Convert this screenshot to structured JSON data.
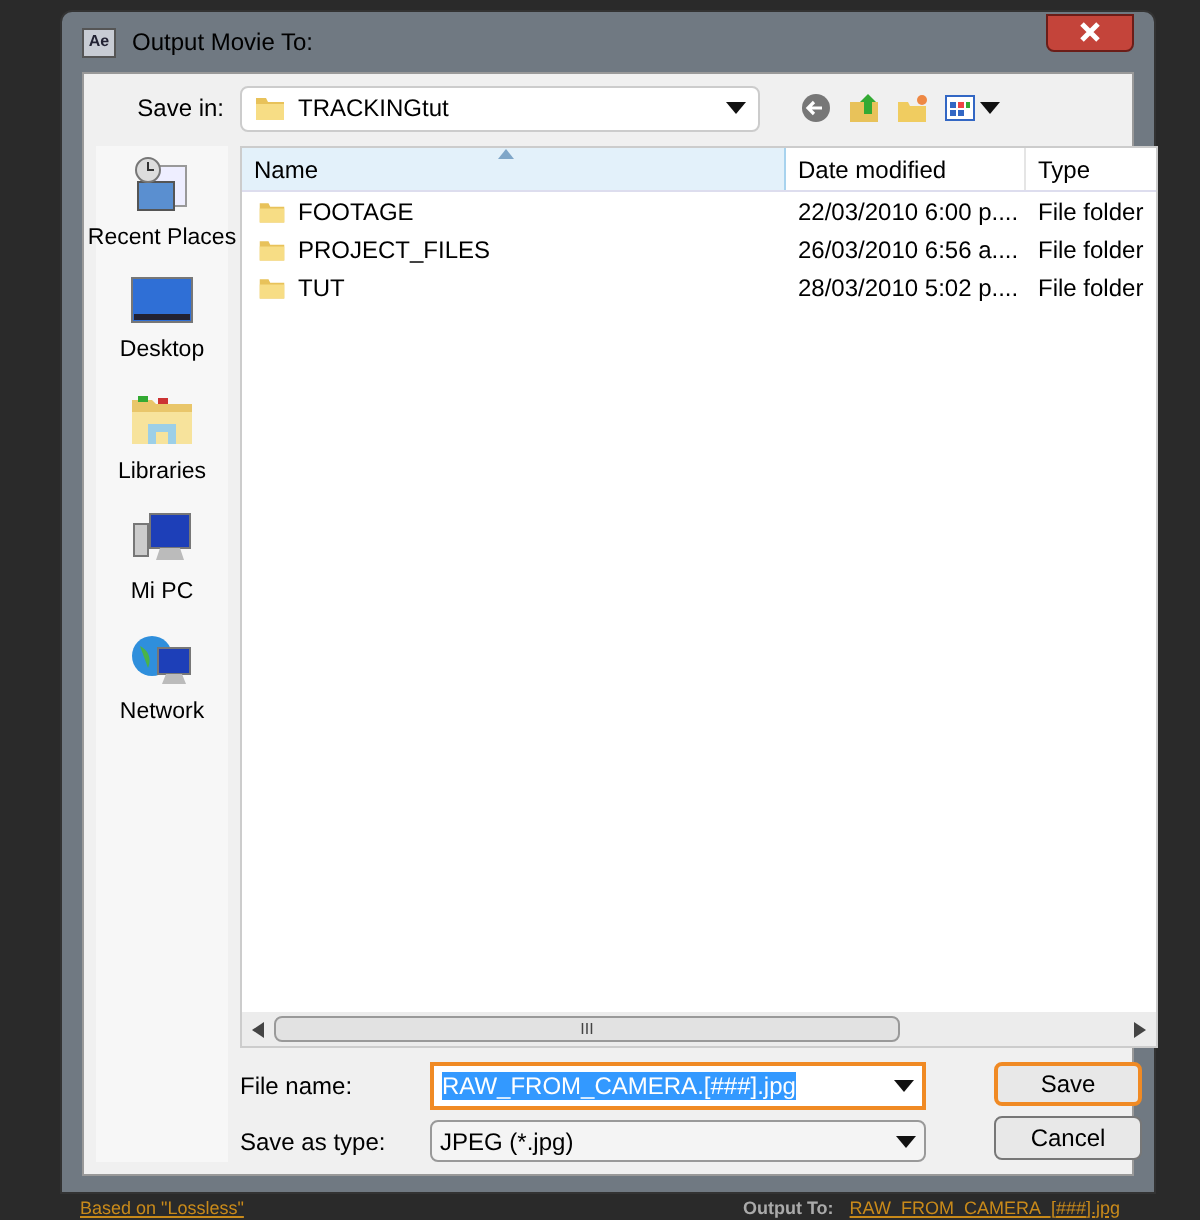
{
  "window": {
    "title": "Output Movie To:",
    "app_icon": "Ae"
  },
  "save_in": {
    "label": "Save in:",
    "value": "TRACKINGtut"
  },
  "sidebar": {
    "items": [
      {
        "label": "Recent Places",
        "kind": "recent"
      },
      {
        "label": "Desktop",
        "kind": "desktop"
      },
      {
        "label": "Libraries",
        "kind": "libraries"
      },
      {
        "label": "Mi PC",
        "kind": "computer"
      },
      {
        "label": "Network",
        "kind": "network"
      }
    ]
  },
  "table": {
    "columns": [
      "Name",
      "Date modified",
      "Type"
    ],
    "rows": [
      {
        "name": "FOOTAGE",
        "date": "22/03/2010 6:00 p....",
        "type": "File folder"
      },
      {
        "name": "PROJECT_FILES",
        "date": "26/03/2010 6:56 a....",
        "type": "File folder"
      },
      {
        "name": "TUT",
        "date": "28/03/2010 5:02 p....",
        "type": "File folder"
      }
    ]
  },
  "scrollbar_grip": "III",
  "file_name": {
    "label": "File name:",
    "value": "RAW_FROM_CAMERA.[###].jpg",
    "highlighted": true
  },
  "save_as_type": {
    "label": "Save as type:",
    "value": "JPEG (*.jpg)"
  },
  "buttons": [
    {
      "label": "Save",
      "highlighted": true
    },
    {
      "label": "Cancel",
      "highlighted": false
    }
  ],
  "background_bar": {
    "based_on": "Based on \"Lossless\"",
    "output_label": "Output To:",
    "output_value": "RAW_FROM_CAMERA_[###].jpg"
  }
}
